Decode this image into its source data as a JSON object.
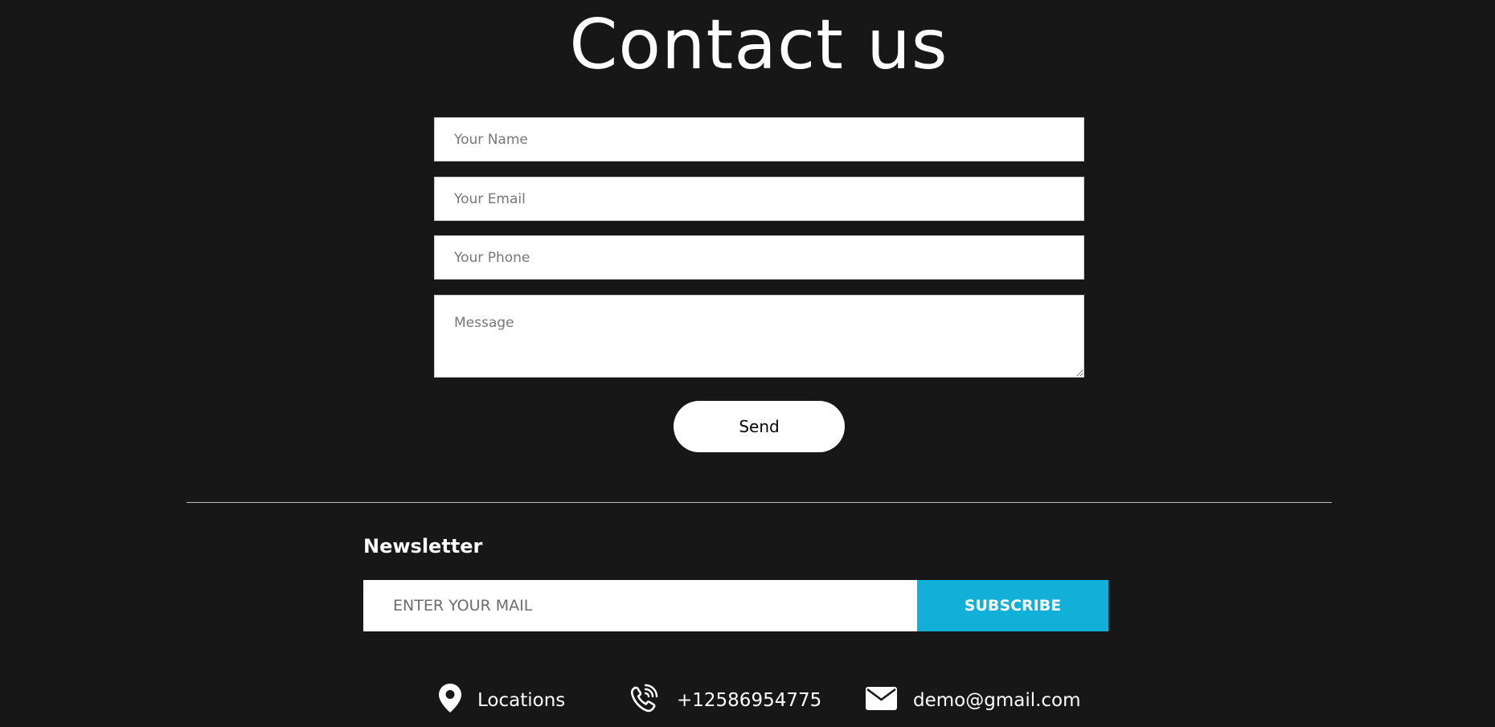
{
  "contact": {
    "heading": "Contact us",
    "name_placeholder": "Your Name",
    "email_placeholder": "Your Email",
    "phone_placeholder": "Your Phone",
    "message_placeholder": "Message",
    "send_label": "Send"
  },
  "newsletter": {
    "heading": "Newsletter",
    "input_placeholder": "ENTER YOUR MAIL",
    "subscribe_label": "SUBSCRIBE",
    "accent_color": "#12b0d9"
  },
  "footer": {
    "items": [
      {
        "icon": "location-pin-icon",
        "label": "Locations"
      },
      {
        "icon": "phone-icon",
        "label": "+12586954775"
      },
      {
        "icon": "envelope-icon",
        "label": "demo@gmail.com"
      }
    ]
  },
  "colors": {
    "background": "#171717",
    "text": "#ffffff"
  }
}
